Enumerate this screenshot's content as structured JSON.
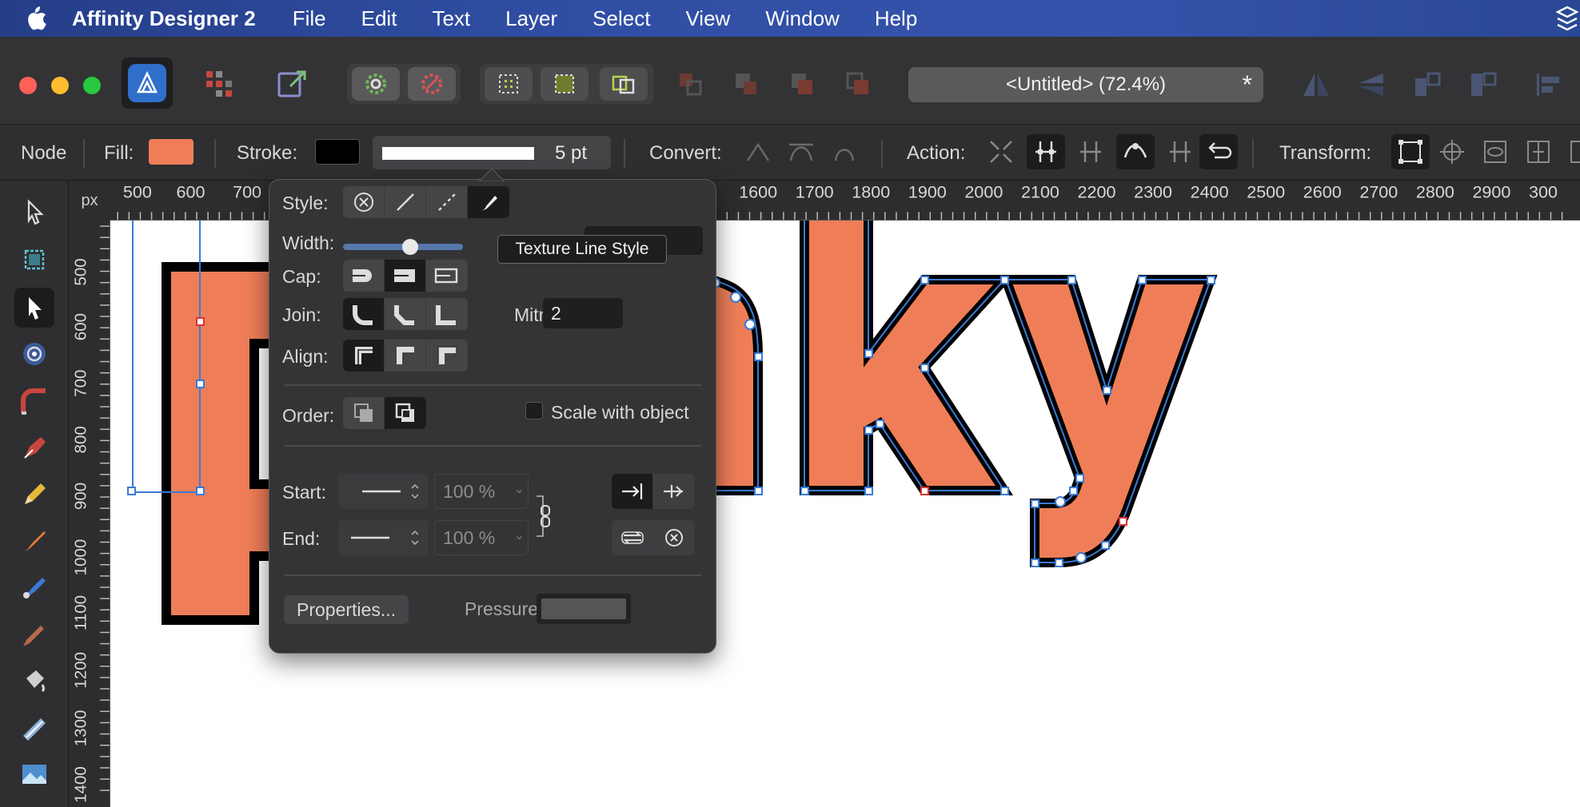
{
  "menubar": {
    "app_name": "Affinity Designer 2",
    "items": [
      "File",
      "Edit",
      "Text",
      "Layer",
      "Select",
      "View",
      "Window",
      "Help"
    ]
  },
  "toolbar": {
    "document_title": "<Untitled> (72.4%)",
    "modified_marker": "*"
  },
  "context_toolbar": {
    "mode_label": "Node",
    "fill_label": "Fill:",
    "fill_color": "#ef7e58",
    "stroke_label": "Stroke:",
    "stroke_color": "#000000",
    "stroke_width": "5 pt",
    "convert_label": "Convert:",
    "action_label": "Action:",
    "transform_label": "Transform:"
  },
  "ruler": {
    "unit": "px",
    "top_ticks": [
      "500",
      "600",
      "700",
      "1600",
      "1700",
      "1800",
      "1900",
      "2000",
      "2100",
      "2200",
      "2300",
      "2400",
      "2500",
      "2600",
      "2700",
      "2800",
      "2900",
      "300"
    ],
    "left_ticks": [
      "500",
      "600",
      "700",
      "800",
      "900",
      "1000",
      "1100",
      "1200",
      "1300",
      "1400"
    ]
  },
  "stroke_panel": {
    "style_label": "Style:",
    "width_label": "Width:",
    "width_fraction": 0.56,
    "cap_label": "Cap:",
    "join_label": "Join:",
    "mitre_label": "Mitre:",
    "mitre_value": "2",
    "align_label": "Align:",
    "order_label": "Order:",
    "scale_with_object_label": "Scale with object",
    "scale_with_object_checked": false,
    "start_label": "Start:",
    "start_percent": "100 %",
    "end_label": "End:",
    "end_percent": "100 %",
    "properties_button": "Properties...",
    "pressure_label": "Pressure:"
  },
  "tooltip": {
    "text": "Texture Line Style"
  },
  "canvas": {
    "text_fill": "#ef7e58",
    "stroke_color": "#000000",
    "selection_color": "#3a7bd5"
  },
  "accent_colors": {
    "menubar": "#2f4ea3",
    "app_icon": "#2f6fc9"
  }
}
